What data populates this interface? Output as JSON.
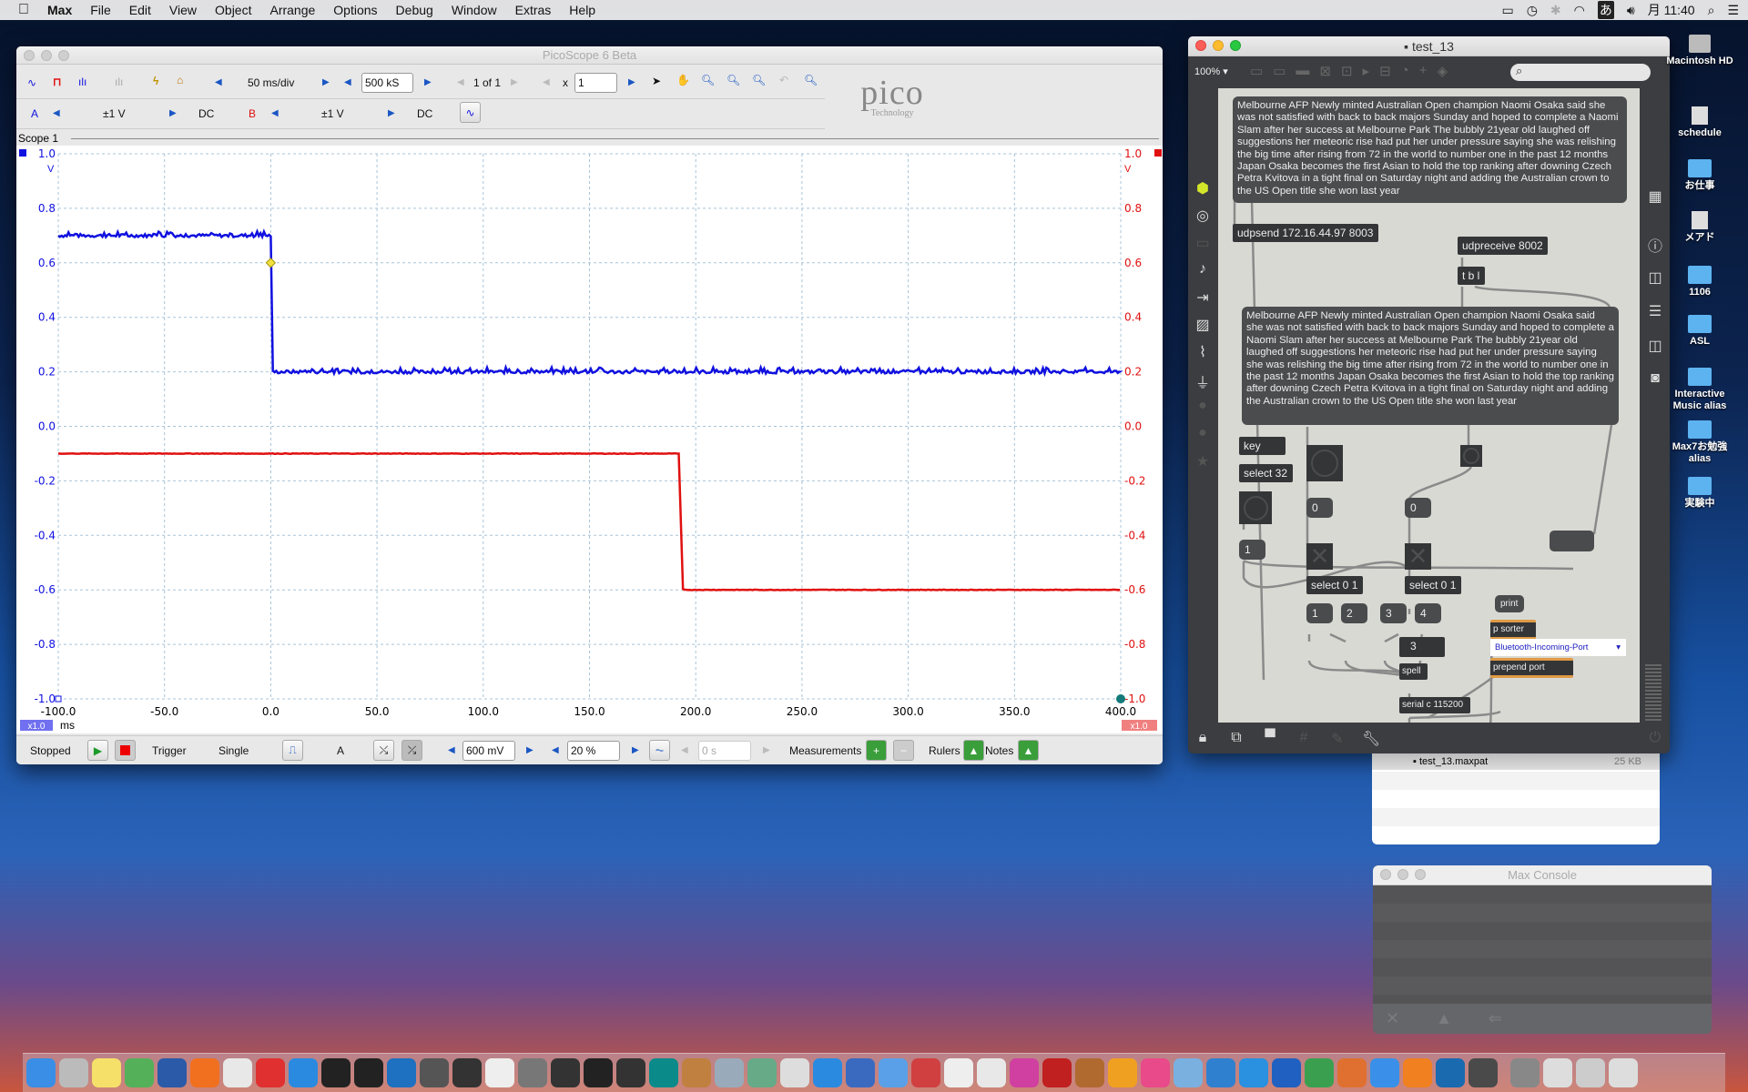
{
  "menubar": {
    "apple": "",
    "items": [
      "Max",
      "File",
      "Edit",
      "View",
      "Object",
      "Arrange",
      "Options",
      "Debug",
      "Window",
      "Extras",
      "Help"
    ],
    "status": {
      "ime": "あ",
      "clock": "月 11:40"
    },
    "status_icons": [
      "airplay-icon",
      "time-machine-icon",
      "bluetooth-icon",
      "wifi-icon",
      "input-method-icon",
      "volume-icon",
      "spotlight-icon",
      "notification-center-icon"
    ]
  },
  "picoscope": {
    "title": "PicoScope 6 Beta",
    "toolbar": {
      "timebase": "50 ms/div",
      "samples": "500 kS",
      "buffer": "1 of 1",
      "x_label": "x",
      "zoom_value": "1"
    },
    "channels": [
      {
        "name": "A",
        "range": "±1 V",
        "coupling": "DC",
        "color": "#1010e0"
      },
      {
        "name": "B",
        "range": "±1 V",
        "coupling": "DC",
        "color": "#e01010"
      }
    ],
    "logo": {
      "text": "pico",
      "sub": "Technology"
    },
    "scope_tab": "Scope 1",
    "axis_unit_left": "V",
    "axis_unit_right": "V",
    "x_unit": "ms",
    "zoom_badge_left": "x1.0",
    "zoom_badge_right": "x1.0",
    "bottom": {
      "status": "Stopped",
      "trigger_label": "Trigger",
      "trigger_mode": "Single",
      "trigger_channel": "A",
      "threshold": "600 mV",
      "pre_trigger": "20 %",
      "delay": "0 s",
      "measurements": "Measurements",
      "rulers": "Rulers",
      "notes": "Notes"
    }
  },
  "chart_data": {
    "type": "line",
    "xlim": [
      -100,
      400
    ],
    "ylim": [
      -1.0,
      1.0
    ],
    "x_ticks": [
      "-100.0",
      "-50.0",
      "0.0",
      "50.0",
      "100.0",
      "150.0",
      "200.0",
      "250.0",
      "300.0",
      "350.0",
      "400.0"
    ],
    "y_ticks": [
      "1.0",
      "0.8",
      "0.6",
      "0.4",
      "0.2",
      "0.0",
      "-0.2",
      "-0.4",
      "-0.6",
      "-0.8",
      "-1.0"
    ],
    "grid": true,
    "trigger_marker": {
      "x": 0,
      "y": 0.6
    },
    "series": [
      {
        "channel": "A",
        "color": "#1010e0",
        "x": [
          -100,
          0,
          1,
          400
        ],
        "y": [
          0.7,
          0.7,
          0.2,
          0.2
        ]
      },
      {
        "channel": "B",
        "color": "#e01010",
        "x": [
          -100,
          192,
          194,
          400
        ],
        "y": [
          -0.1,
          -0.1,
          -0.6,
          -0.6
        ]
      }
    ]
  },
  "max": {
    "title": "test_13",
    "zoom": "100%",
    "comment1": "Melbourne AFP Newly minted Australian Open champion Naomi Osaka said she was not satisfied with back to back majors Sunday and hoped to complete a Naomi Slam after her success at Melbourne Park The bubbly 21year old laughed off suggestions her meteoric rise had put her under pressure saying she was relishing the big time after rising from 72 in the world to number one in the past 12 months Japan Osaka becomes the first Asian to hold the top ranking after downing Czech Petra Kvitova in a tight final on Saturday night and adding the Australian crown to the US Open title she won last year",
    "comment2": "Melbourne AFP Newly minted Australian Open champion Naomi Osaka said she was not satisfied with back to back majors Sunday and hoped to complete a Naomi Slam after her success at Melbourne Park The bubbly 21year old laughed off suggestions her meteoric rise had put her under pressure saying she was relishing the big time after rising from 72 in the world to number one in the past 12 months Japan Osaka becomes the first Asian to hold the top ranking after downing Czech Petra Kvitova in a tight final on Saturday night and adding the Australian crown to the US Open title she won last year",
    "objects": {
      "udpsend": "udpsend 172.16.44.97 8003",
      "udpreceive": "udpreceive 8002",
      "tbl": "t b l",
      "key": "key",
      "select32": "select 32",
      "select01a": "select 0 1",
      "select01b": "select 0 1",
      "print": "print",
      "psorter": "p sorter",
      "prepend": "prepend port",
      "spell": "spell",
      "serial": "serial c 115200"
    },
    "numbers": {
      "num0a": "0",
      "num0b": "0",
      "num3": "3"
    },
    "messages": {
      "m1": "1",
      "ma": "1",
      "mb": "2",
      "mc": "3",
      "md": "4",
      "blank": ""
    },
    "umenu": "Bluetooth-Incoming-Port"
  },
  "finder": {
    "file": "test_13.maxpat",
    "size": "25 KB"
  },
  "console": {
    "title": "Max Console"
  },
  "desktop": [
    "Macintosh HD",
    "schedule",
    "お仕事",
    "メアド",
    "1106",
    "ASL",
    "Interactive Music alias",
    "Max7お勉強 alias",
    "実験中"
  ],
  "dock": {
    "icons": [
      "finder",
      "launchpad",
      "notes",
      "maps",
      "sourcetree",
      "firefox",
      "chrome",
      "vivaldi",
      "safari",
      "max",
      "terminal",
      "vscode",
      "scrivener",
      "8ball",
      "pd",
      "virtualbox",
      "processing",
      "pdf",
      "pages",
      "arduino",
      "cat",
      "preview",
      "qgis",
      "rocket",
      "dropbox",
      "keynote",
      "mail",
      "toolbox",
      "textedit",
      "calendar",
      "music",
      "acrobat",
      "guitar",
      "clipboard",
      "itunes",
      "photos",
      "mac-app",
      "mail2",
      "picoscope",
      "numbers",
      "keynote2",
      "appstore",
      "vlc",
      "quicktime",
      "keynote3",
      "sysprefs",
      "downloads",
      "documents",
      "trash"
    ]
  }
}
